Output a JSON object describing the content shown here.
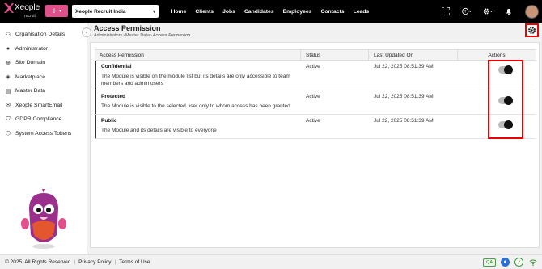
{
  "app": {
    "logo_text": "Xeople",
    "logo_sub": "recruit"
  },
  "topbar": {
    "plus_label": "+",
    "company": "Xeople Recruit India",
    "nav": [
      "Home",
      "Clients",
      "Jobs",
      "Candidates",
      "Employees",
      "Contacts",
      "Leads"
    ],
    "icons": [
      "fullscreen-icon",
      "help-icon",
      "gear-icon",
      "bell-icon"
    ]
  },
  "sidebar": {
    "items": [
      {
        "label": "Organisation Details",
        "icon": "org-icon"
      },
      {
        "label": "Administrator",
        "icon": "user-icon"
      },
      {
        "label": "Site Domain",
        "icon": "globe-icon"
      },
      {
        "label": "Marketplace",
        "icon": "marketplace-icon"
      },
      {
        "label": "Master Data",
        "icon": "database-icon"
      },
      {
        "label": "Xeople SmartEmail",
        "icon": "email-icon"
      },
      {
        "label": "GDPR Compliance",
        "icon": "shield-icon"
      },
      {
        "label": "System Access Tokens",
        "icon": "token-icon"
      }
    ]
  },
  "page": {
    "title": "Access Permission",
    "breadcrumb": [
      "Administrators",
      "Master Data",
      "Access Permission"
    ]
  },
  "table": {
    "headers": [
      "Access Permission",
      "Status",
      "Last Updated On",
      "Actions"
    ],
    "rows": [
      {
        "name": "Confidential",
        "desc": "The Module is visible on the module list but its details are only accessible to team members and admin users",
        "status": "Active",
        "updated": "Jul 22, 2025 08:51:39 AM",
        "enabled": true
      },
      {
        "name": "Protected",
        "desc": "The Module is visible to the selected user only to whom access has been granted",
        "status": "Active",
        "updated": "Jul 22, 2025 08:51:39 AM",
        "enabled": true
      },
      {
        "name": "Public",
        "desc": "The Module and its details are visible to everyone",
        "status": "Active",
        "updated": "Jul 22, 2025 08:51:39 AM",
        "enabled": true
      }
    ]
  },
  "footer": {
    "copyright": "© 2025. All Rights Reserved",
    "privacy": "Privacy Policy",
    "terms": "Terms of Use",
    "qa": "QA"
  },
  "colors": {
    "accent_pink": "#e0508a",
    "highlight_red": "#ee0000"
  }
}
